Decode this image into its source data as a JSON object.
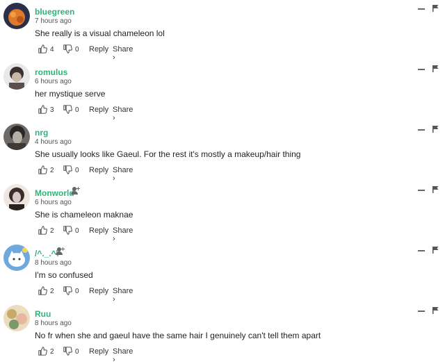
{
  "comments": [
    {
      "username": "bluegreen",
      "timestamp": "7 hours ago",
      "text": "She really is a visual chameleon lol",
      "likes": "4",
      "dislikes": "0",
      "reply_label": "Reply",
      "share_label": "Share ›",
      "has_add_user_icon": false,
      "avatar_colors": [
        "#2b2f4a",
        "#e07a2a",
        "#f0a040"
      ]
    },
    {
      "username": "romulus",
      "timestamp": "6 hours ago",
      "text": "her mystique serve",
      "likes": "3",
      "dislikes": "0",
      "reply_label": "Reply",
      "share_label": "Share ›",
      "has_add_user_icon": false,
      "avatar_colors": [
        "#e8e8e8",
        "#3a3030",
        "#c9b7a8"
      ]
    },
    {
      "username": "nrg",
      "timestamp": "4 hours ago",
      "text": "She usually looks like Gaeul. For the rest it's mostly a makeup/hair thing",
      "likes": "2",
      "dislikes": "0",
      "reply_label": "Reply",
      "share_label": "Share ›",
      "has_add_user_icon": false,
      "avatar_colors": [
        "#6d6a68",
        "#2a2726",
        "#b7aea6"
      ]
    },
    {
      "username": "Monworld",
      "timestamp": "6 hours ago",
      "text": "She is chameleon maknae",
      "likes": "2",
      "dislikes": "0",
      "reply_label": "Reply",
      "share_label": "Share ›",
      "has_add_user_icon": true,
      "avatar_colors": [
        "#d8c8c4",
        "#3a2c2a",
        "#efe6e2"
      ]
    },
    {
      "username": "/^._.^\\",
      "timestamp": "8 hours ago",
      "text": "I'm so confused",
      "likes": "2",
      "dislikes": "0",
      "reply_label": "Reply",
      "share_label": "Share ›",
      "has_add_user_icon": true,
      "avatar_colors": [
        "#6fa8dc",
        "#ffffff",
        "#f4d35e"
      ]
    },
    {
      "username": "Ruu",
      "timestamp": "8 hours ago",
      "text": "No fr when she and gaeul have the same hair I genuinely can't tell them apart",
      "likes": "2",
      "dislikes": "0",
      "reply_label": "Reply",
      "share_label": "Share ›",
      "has_add_user_icon": false,
      "avatar_colors": [
        "#e9dcc0",
        "#c7a96a",
        "#7a9a6a"
      ]
    }
  ],
  "colors": {
    "username": "#2db57a",
    "text": "#222222",
    "muted": "#555555"
  },
  "icons": {
    "like": "thumbs-up-icon",
    "dislike": "thumbs-down-icon",
    "collapse": "minus-icon",
    "flag": "flag-icon",
    "add_user": "add-user-icon"
  }
}
